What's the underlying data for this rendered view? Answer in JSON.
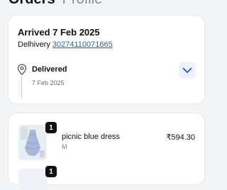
{
  "tabs": [
    {
      "label": "Orders"
    },
    {
      "label": "Profile"
    }
  ],
  "shipment": {
    "arrived_label": "Arrived 7 Feb 2025",
    "carrier": "Delhivery",
    "tracking_number": "30274110071665",
    "status": "Delivered",
    "status_date": "7 Feb 2025",
    "icons": {
      "pin": "map-pin-icon",
      "expand": "chevron-down-icon"
    }
  },
  "items": [
    {
      "name": "picnic blue dress",
      "size": "M",
      "price": "₹594.30",
      "quantity": "1"
    },
    {
      "quantity": "1"
    }
  ],
  "colors": {
    "link": "#1a67b3",
    "accent_bg": "#eef2ff"
  }
}
